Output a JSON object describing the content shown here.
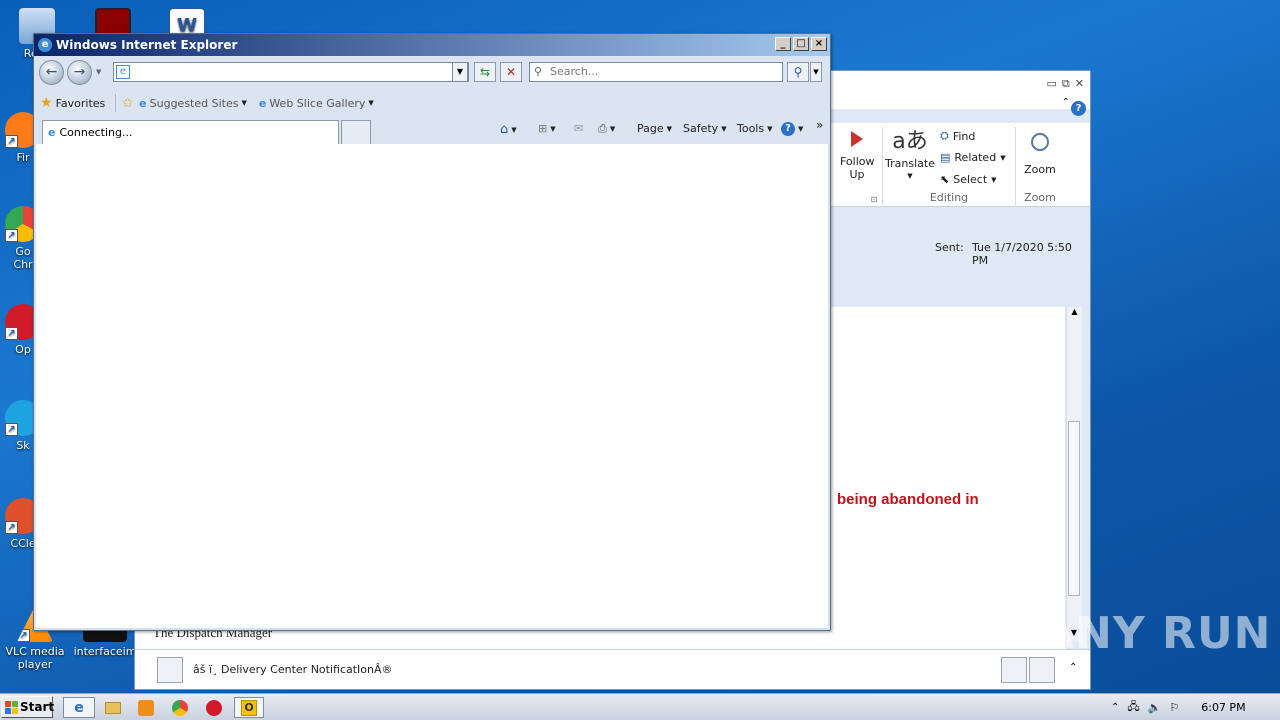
{
  "desktop": {
    "icons": [
      {
        "label": "Recy",
        "color": "#7aa6d6"
      },
      {
        "label": "Fir",
        "color": "#ff7a18"
      },
      {
        "label": "Go\nChr",
        "color": "#34a853"
      },
      {
        "label": "Op",
        "color": "#d11a2a"
      },
      {
        "label": "Sk",
        "color": "#1fa3e0"
      },
      {
        "label": "CCle",
        "color": "#e0502a"
      },
      {
        "label": "VLC media player",
        "color": "#ff8800"
      },
      {
        "label": "interfaceim",
        "color": "#111111"
      }
    ]
  },
  "outlook": {
    "ribbon": {
      "follow_up": "Follow Up",
      "translate": "Translate",
      "find": "Find",
      "related": "Related",
      "select": "Select",
      "zoom_button": "Zoom",
      "group_editing": "Editing",
      "group_zoom": "Zoom"
    },
    "sent_label": "Sent:",
    "sent_value": "Tue 1/7/2020 5:50 PM",
    "body_red_text": "being abandoned in",
    "body_signature": "The Dispatch Manager",
    "footer_sender": "âš ï¸ Delivery Center NotificatIonÂ®"
  },
  "ie": {
    "window_title": "Windows Internet Explorer",
    "address_value": "",
    "search_placeholder": "Search...",
    "favorites": "Favorites",
    "suggested_sites": "Suggested Sites",
    "web_slice_gallery": "Web Slice Gallery",
    "tab_label": "Connecting...",
    "cmd_page": "Page",
    "cmd_safety": "Safety",
    "cmd_tools": "Tools"
  },
  "taskbar": {
    "start": "Start",
    "clock": "6:07 PM"
  },
  "watermark": "ANY RUN"
}
